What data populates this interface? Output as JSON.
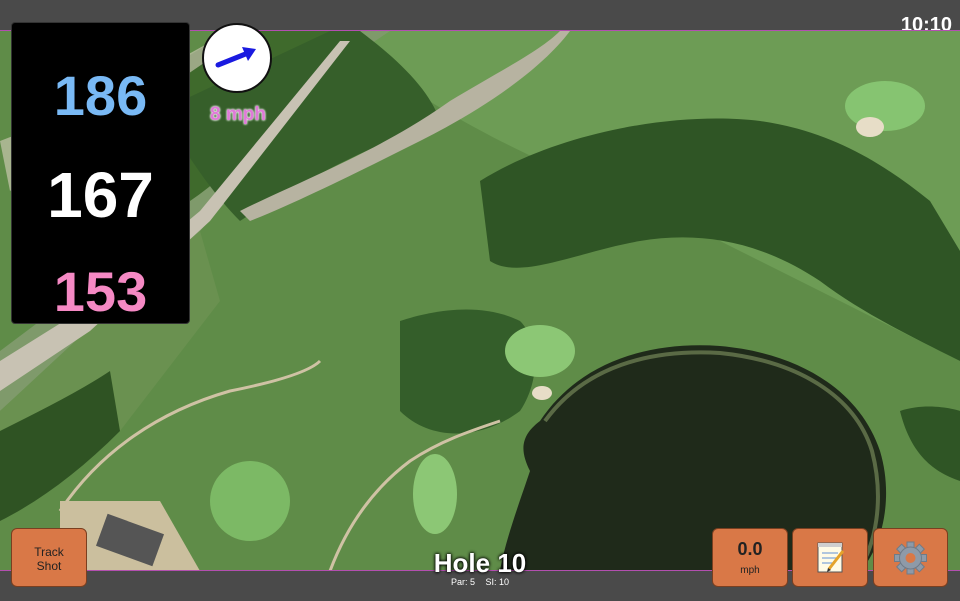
{
  "status": {
    "time": "10:10"
  },
  "distances": {
    "back": "186",
    "center": "167",
    "front": "153"
  },
  "wind": {
    "speed": "8 mph",
    "icon": "wind-direction-arrow-icon"
  },
  "buttons": {
    "track_shot": [
      "Track",
      "Shot"
    ],
    "speed_value": "0.0",
    "speed_unit": "mph",
    "notes_icon": "notepad-icon",
    "settings_icon": "gear-icon"
  },
  "hole": {
    "title": "Hole 10",
    "par": "Par: 5",
    "si": "SI: 10"
  },
  "colors": {
    "back_distance": "#79b9f5",
    "center_distance": "#ffffff",
    "front_distance": "#f589c4",
    "wind_label": "#e07ad8",
    "button": "#d97847",
    "frame": "#4a4a4a",
    "accent_line": "#b34fb0"
  }
}
